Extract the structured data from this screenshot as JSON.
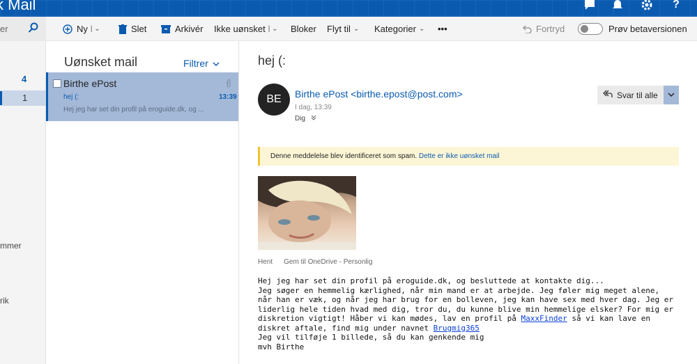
{
  "header": {
    "title": "k Mail",
    "icons": [
      "chat-icon",
      "bell-icon",
      "gear-icon",
      "help-icon"
    ],
    "help_label": "?"
  },
  "toolbar": {
    "search_placeholder": "er",
    "new_label": "Ny",
    "delete_label": "Slet",
    "archive_label": "Arkivér",
    "junk_label": "Ikke uønsket",
    "block_label": "Bloker",
    "move_label": "Flyt til",
    "categories_label": "Kategorier",
    "more_label": "•••",
    "undo_label": "Fortryd",
    "beta_label": "Prøv betaversionen"
  },
  "leftnav": {
    "counts": [
      "4",
      "1"
    ],
    "labels": [
      "mmer",
      "rik"
    ]
  },
  "message_list": {
    "folder_title": "Uønsket mail",
    "filter_label": "Filtrer",
    "items": [
      {
        "sender": "Birthe ePost",
        "subject": "hej (:",
        "time": "13:39",
        "preview": "Hej jeg har set din profil på eroguide.dk, og ..."
      }
    ]
  },
  "reading": {
    "subject": "hej (:",
    "avatar_initials": "BE",
    "from": "Birthe ePost <birthe.epost@post.com>",
    "date": "I dag, 13:39",
    "to": "Dig",
    "reply_all_label": "Svar til alle",
    "spam_text": "Denne meddelelse blev identificeret som spam.",
    "spam_link": "Dette er ikke uønsket mail",
    "attachment_actions": [
      "Hent",
      "Gem til OneDrive - Personlig"
    ],
    "body": {
      "line1": "Hej jeg har set din profil på eroguide.dk, og besluttede at kontakte dig...",
      "para_before_link": "Jeg søger en hemmelig kærlighed, når min mand er at arbejde. Jeg føler mig meget alene, når han er væk, og når jeg har brug for en bolleven, jeg kan have sex med hver dag. Jeg er liderlig hele tiden hvad med dig, tror du, du kunne blive min hemmelige elsker? For mig er diskretion vigtigt! Håber vi kan mødes, lav en profil på ",
      "link1": "MaxxFinder",
      "para_mid": " så vi kan lave en diskret aftale, find mig under navnet ",
      "link2": "Brugmig365",
      "line_photo": "Jeg vil tilføje 1 billede, så du kan genkende mig",
      "signoff": "mvh Birthe"
    }
  },
  "colors": {
    "brand": "#0a5bb0",
    "selected_item": "#a4b9d8",
    "spam_banner": "#fdf6d6",
    "spam_accent": "#f2c232"
  }
}
